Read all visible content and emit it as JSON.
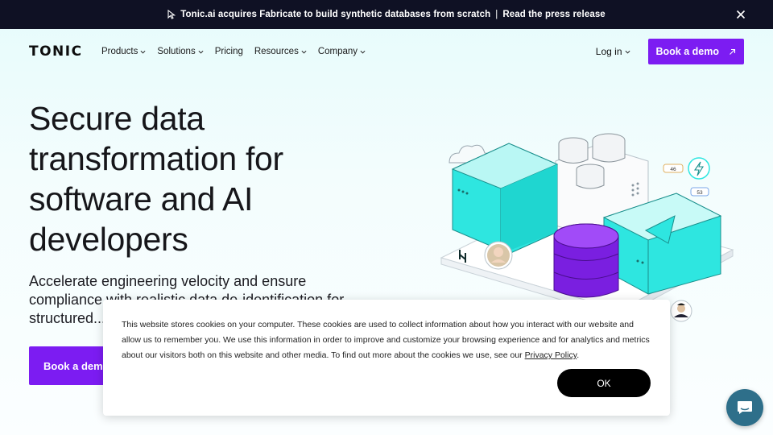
{
  "announcement": {
    "text": "Tonic.ai acquires Fabricate to build synthetic databases from scratch",
    "separator": "|",
    "link": "Read the press release"
  },
  "nav": {
    "logo": "TONIC",
    "menu": [
      {
        "label": "Products"
      },
      {
        "label": "Solutions"
      },
      {
        "label": "Pricing"
      },
      {
        "label": "Resources"
      },
      {
        "label": "Company"
      }
    ],
    "login": "Log in",
    "cta": "Book a demo"
  },
  "hero": {
    "title": "Secure data transformation for software and AI developers",
    "subtitle": "Accelerate engineering velocity and ensure compliance with realistic data de-identification for structured...",
    "cta": "Book a demo"
  },
  "illustration": {
    "badge1": "46",
    "badge2": "53"
  },
  "cookie": {
    "text": "This website stores cookies on your computer. These cookies are used to collect information about how you interact with our website and allow us to remember you. We use this information in order to improve and customize your browsing experience and for analytics and metrics about our visitors both on this website and other media. To find out more about the cookies we use, see our ",
    "policy_link": "Privacy Policy",
    "end": ".",
    "ok": "OK"
  },
  "colors": {
    "accent": "#7c1cf2",
    "teal": "#2ee6e0",
    "dark": "#0f1124"
  }
}
